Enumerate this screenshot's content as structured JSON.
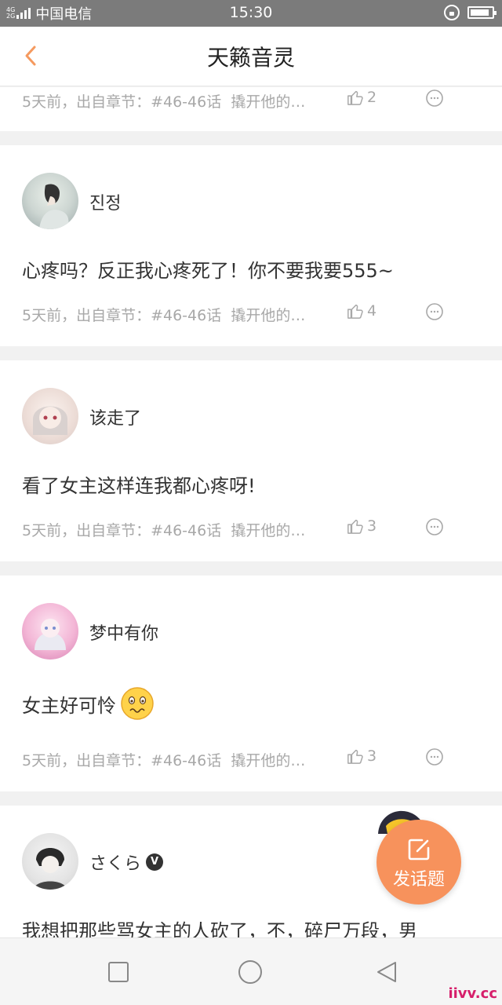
{
  "status_bar": {
    "net_top": "4G",
    "net_bottom": "2G",
    "carrier": "中国电信",
    "time": "15:30",
    "battery_percent": 90
  },
  "nav": {
    "title": "天籁音灵",
    "back_icon": "chevron-left-icon",
    "accent_color": "#f59a5f"
  },
  "partial_post": {
    "time": "5天前，出自章节：#46-46话",
    "source": "撬开他的…",
    "likes": "2"
  },
  "posts": [
    {
      "username": "진정",
      "verified": false,
      "content": "心疼吗？反正我心疼死了！你不要我要555~",
      "time": "5天前，出自章节：#46-46话",
      "source": "撬开他的…",
      "likes": "4"
    },
    {
      "username": "该走了",
      "verified": false,
      "content": "看了女主这样连我都心疼呀!",
      "time": "5天前，出自章节：#46-46话",
      "source": "撬开他的…",
      "likes": "3"
    },
    {
      "username": "梦中有你",
      "verified": false,
      "content": "女主好可怜",
      "emoji": "worried-face-emoji",
      "time": "5天前，出自章节：#46-46话",
      "source": "撬开他的…",
      "likes": "3"
    },
    {
      "username": "さくら",
      "verified": true,
      "verified_label": "V",
      "content": "我想把那些骂女主的人砍了，不，碎尸万段，男"
    }
  ],
  "fab": {
    "label": "发话题",
    "color": "#f7925c"
  },
  "watermark": "iivv.cc"
}
